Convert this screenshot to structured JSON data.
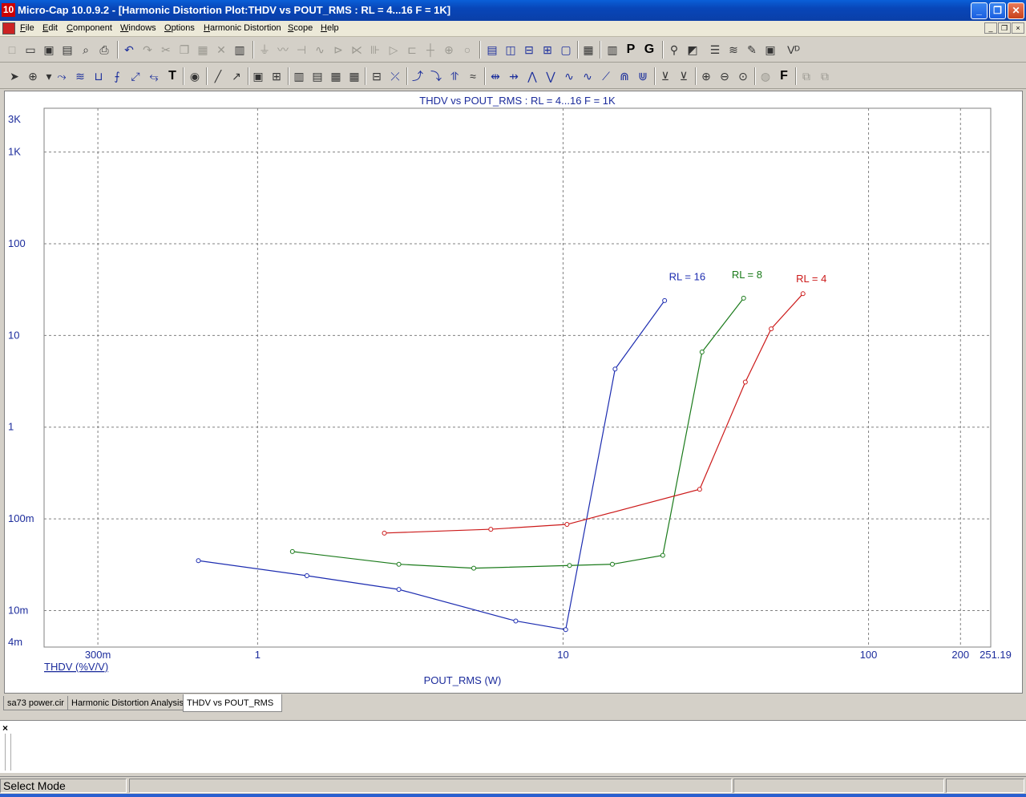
{
  "window": {
    "app_icon_text": "10",
    "title": "Micro-Cap 10.0.9.2 - [Harmonic Distortion Plot:THDV vs POUT_RMS : RL = 4...16 F = 1K]",
    "minimize": "_",
    "restore": "❐",
    "close": "✕"
  },
  "menu": {
    "items": [
      {
        "label": "File",
        "key": "F",
        "rest": "ile"
      },
      {
        "label": "Edit",
        "key": "E",
        "rest": "dit"
      },
      {
        "label": "Component",
        "key": "C",
        "rest": "omponent"
      },
      {
        "label": "Windows",
        "key": "W",
        "rest": "indows"
      },
      {
        "label": "Options",
        "key": "O",
        "rest": "ptions"
      },
      {
        "label": "Harmonic Distortion",
        "key": "H",
        "rest": "armonic Distortion"
      },
      {
        "label": "Scope",
        "key": "S",
        "rest": "cope"
      },
      {
        "label": "Help",
        "key": "H",
        "rest": "elp"
      }
    ],
    "mdi_min": "_",
    "mdi_restore": "❐",
    "mdi_close": "×"
  },
  "toolbar2": {
    "text_tool": "T",
    "p_button": "P",
    "g_button": "G",
    "f_button": "F"
  },
  "tabs": [
    {
      "label": "sa73 power.cir"
    },
    {
      "label": "Harmonic Distortion Analysis"
    },
    {
      "label": "THDV vs POUT_RMS"
    }
  ],
  "output": {
    "close_glyph": "×"
  },
  "status": {
    "mode": "Select Mode"
  },
  "colors": {
    "axis_text": "#1c2c9c",
    "grid": "#808080",
    "rl16": "#1c2cb0",
    "rl8": "#1a7a1a",
    "rl4": "#cc1a1a"
  },
  "chart_data": {
    "type": "line",
    "title": "THDV vs POUT_RMS : RL = 4...16 F = 1K",
    "xlabel": "POUT_RMS (W)",
    "ylabel": "THDV (%V/V)",
    "x_scale": "log",
    "y_scale": "log",
    "xlim": [
      0.2,
      251.19
    ],
    "ylim": [
      0.004,
      3000
    ],
    "x_ticks": [
      {
        "value": 0.3,
        "label": "300m"
      },
      {
        "value": 1,
        "label": "1"
      },
      {
        "value": 10,
        "label": "10"
      },
      {
        "value": 100,
        "label": "100"
      },
      {
        "value": 200,
        "label": "200"
      },
      {
        "value": 251.19,
        "label": "251.19"
      }
    ],
    "y_ticks": [
      {
        "value": 0.004,
        "label": "4m"
      },
      {
        "value": 0.01,
        "label": "10m"
      },
      {
        "value": 0.1,
        "label": "100m"
      },
      {
        "value": 1,
        "label": "1"
      },
      {
        "value": 10,
        "label": "10"
      },
      {
        "value": 100,
        "label": "100"
      },
      {
        "value": 1000,
        "label": "1K"
      },
      {
        "value": 3000,
        "label": "3K"
      }
    ],
    "grid": true,
    "series": [
      {
        "name": "RL = 16",
        "color": "#1c2cb0",
        "points": [
          [
            0.64,
            0.035
          ],
          [
            1.45,
            0.024
          ],
          [
            2.9,
            0.017
          ],
          [
            7,
            0.0077
          ],
          [
            10.2,
            0.0062
          ],
          [
            14.8,
            4.3
          ],
          [
            21.5,
            24
          ]
        ]
      },
      {
        "name": "RL = 8",
        "color": "#1a7a1a",
        "points": [
          [
            1.3,
            0.044
          ],
          [
            2.9,
            0.032
          ],
          [
            5.1,
            0.029
          ],
          [
            10.5,
            0.031
          ],
          [
            14.5,
            0.032
          ],
          [
            21.2,
            0.04
          ],
          [
            28.5,
            6.6
          ],
          [
            39,
            25.5
          ]
        ]
      },
      {
        "name": "RL = 4",
        "color": "#cc1a1a",
        "points": [
          [
            2.6,
            0.07
          ],
          [
            5.8,
            0.077
          ],
          [
            10.3,
            0.087
          ],
          [
            28,
            0.21
          ],
          [
            39.5,
            3.1
          ],
          [
            48,
            11.8
          ],
          [
            61,
            28.5
          ]
        ]
      }
    ],
    "series_labels": [
      {
        "series": "RL = 16",
        "anchor_x": 25.5,
        "anchor_y": 40
      },
      {
        "series": "RL = 8",
        "anchor_x": 40,
        "anchor_y": 42
      },
      {
        "series": "RL = 4",
        "anchor_x": 65,
        "anchor_y": 38
      }
    ]
  }
}
